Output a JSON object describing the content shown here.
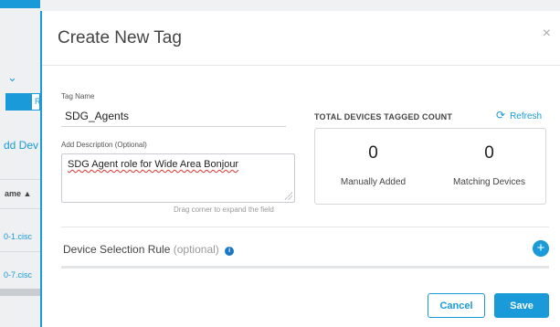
{
  "background": {
    "toggle_label": "R",
    "add_device_text": "dd Dev",
    "column_header": "ame ▲",
    "row1": "0-1.cisc",
    "row2": "0-7.cisc"
  },
  "modal": {
    "title": "Create New Tag",
    "close_icon": "×",
    "tag_name_label": "Tag Name",
    "tag_name_value": "SDG_Agents",
    "description_label": "Add Description (Optional)",
    "description_value": "SDG Agent role for Wide Area Bonjour",
    "drag_hint": "Drag corner to expand the field",
    "count_title": "TOTAL DEVICES TAGGED COUNT",
    "refresh_label": "Refresh",
    "counts": [
      {
        "value": "0",
        "label": "Manually Added"
      },
      {
        "value": "0",
        "label": "Matching Devices"
      }
    ],
    "rule_title": "Device Selection Rule",
    "rule_optional": "(optional)",
    "info_icon": "i",
    "add_icon": "+",
    "cancel_label": "Cancel",
    "save_label": "Save"
  },
  "colors": {
    "accent": "#1a9ad8",
    "text": "#444444",
    "border": "#d5d8db"
  }
}
